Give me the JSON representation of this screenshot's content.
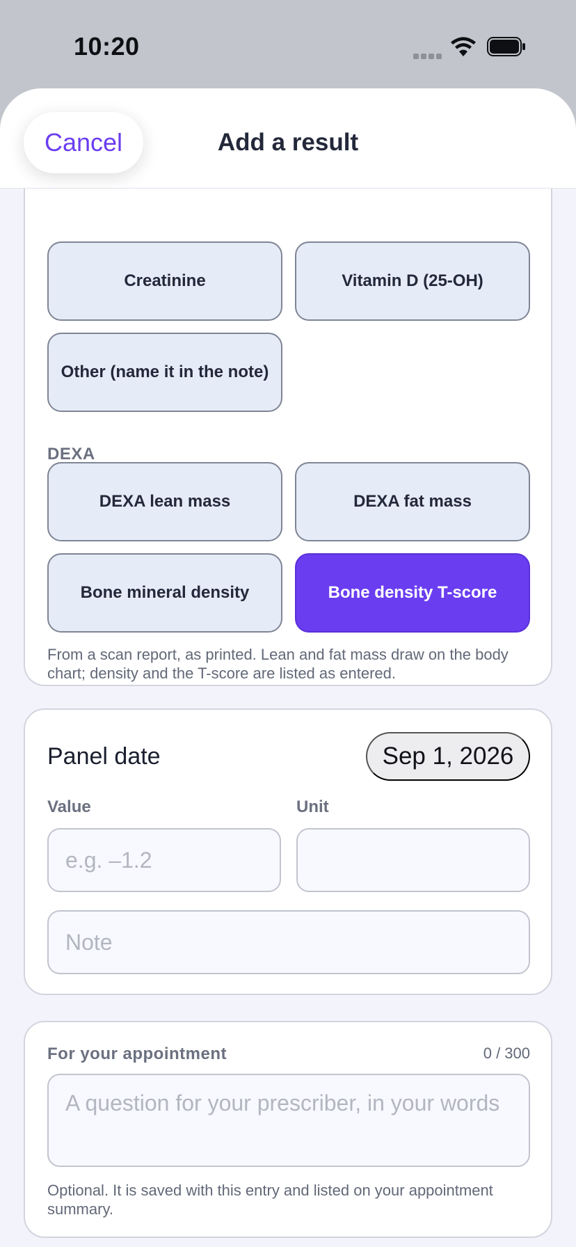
{
  "status_bar": {
    "time": "10:20"
  },
  "header": {
    "cancel_label": "Cancel",
    "title": "Add a result"
  },
  "tests": {
    "blood_items": [
      "Creatinine",
      "Vitamin D (25-OH)",
      "Other (name it in the note)"
    ],
    "dexa_label": "DEXA",
    "dexa_items": [
      "DEXA lean mass",
      "DEXA fat mass",
      "Bone mineral density",
      "Bone density T-score"
    ],
    "selected": "Bone density T-score",
    "dexa_hint": "From a scan report, as printed. Lean and fat mass draw on the body chart; density and the T-score are listed as entered."
  },
  "entry": {
    "date_label": "Panel date",
    "date_value": "Sep 1, 2026",
    "value_label": "Value",
    "value_placeholder": "e.g. –1.2",
    "unit_label": "Unit",
    "unit_value": "",
    "note_placeholder": "Note"
  },
  "appointment": {
    "label": "For your appointment",
    "counter": "0 / 300",
    "question_placeholder": "A question for your prescriber, in your words",
    "hint": "Optional. It is saved with this entry and listed on your appointment summary."
  },
  "colors": {
    "accent": "#6a3df0",
    "chip_bg": "#e6ebf8",
    "sheet_bg": "#f3f4fb"
  },
  "icons": [
    "cellular-signal-icon",
    "wifi-icon",
    "battery-icon"
  ]
}
